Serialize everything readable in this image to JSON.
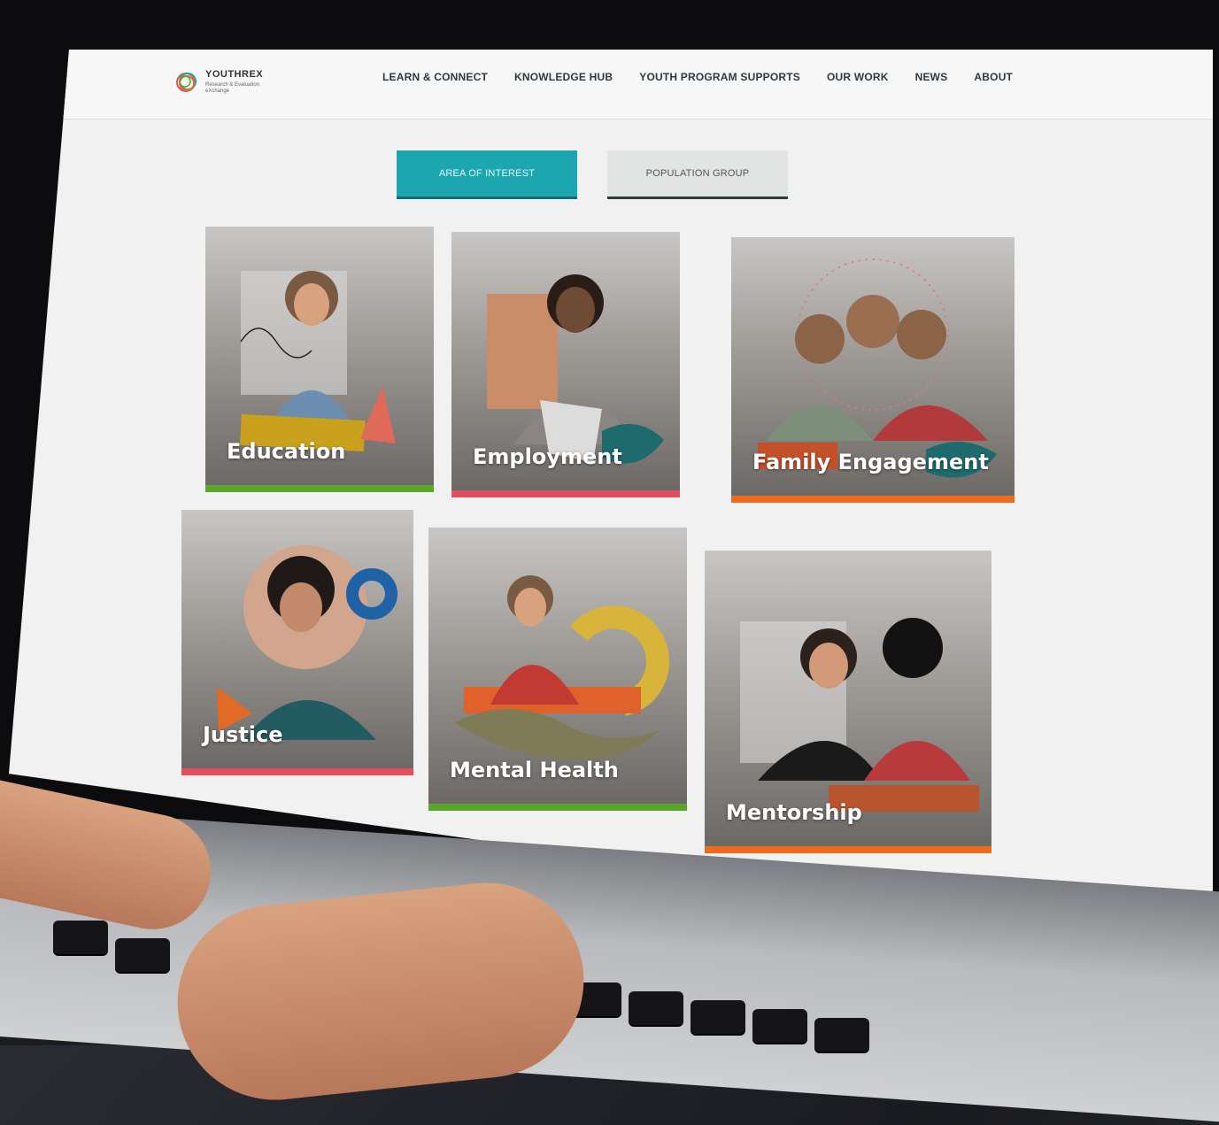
{
  "logo": {
    "title": "YOUTHREX",
    "subtitle": "Research & Evaluation eXchange"
  },
  "nav": [
    {
      "label": "LEARN & CONNECT"
    },
    {
      "label": "KNOWLEDGE HUB"
    },
    {
      "label": "YOUTH PROGRAM SUPPORTS"
    },
    {
      "label": "OUR WORK"
    },
    {
      "label": "NEWS"
    },
    {
      "label": "ABOUT"
    }
  ],
  "tabs": {
    "area_of_interest": "AREA OF INTEREST",
    "population_group": "POPULATION GROUP"
  },
  "cards": [
    {
      "label": "Education",
      "accent": "#5aa52a"
    },
    {
      "label": "Employment",
      "accent": "#e0505e"
    },
    {
      "label": "Family Engagement",
      "accent": "#ef6a1f"
    },
    {
      "label": "Justice",
      "accent": "#e0505e"
    },
    {
      "label": "Mental Health",
      "accent": "#5aa52a"
    },
    {
      "label": "Mentorship",
      "accent": "#ef6a1f"
    }
  ],
  "colors": {
    "teal": "#1ba6b0",
    "green": "#5aa52a",
    "pink": "#e0505e",
    "orange": "#ef6a1f"
  }
}
